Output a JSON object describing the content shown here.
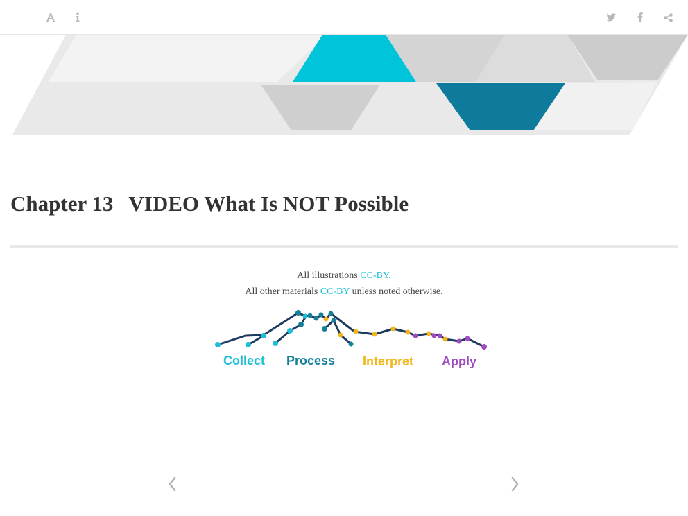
{
  "toolbar": {
    "font_icon": "font-icon",
    "info_icon": "info-icon",
    "twitter_icon": "twitter-icon",
    "facebook_icon": "facebook-icon",
    "share_icon": "share-icon"
  },
  "banner": {
    "colors": [
      "#00c4da",
      "#0e7a9c",
      "#e6e6e6"
    ]
  },
  "chapter": {
    "number": "Chapter 13",
    "title": "VIDEO What Is NOT Possible"
  },
  "credits": {
    "line1_prefix": "All illustrations ",
    "line1_link": "CC-BY.",
    "line2_prefix": "All other materials ",
    "line2_link": "CC-BY",
    "line2_suffix": " unless noted otherwise."
  },
  "logo": {
    "labels": [
      "Collect",
      "Process",
      "Interpret",
      "Apply"
    ],
    "colors": {
      "collect": "#1ebfd6",
      "process": "#167f99",
      "interpret": "#f2b51b",
      "apply": "#a04ac3",
      "line": "#1e3a5f"
    }
  },
  "nav": {
    "prev_icon": "chevron-left-icon",
    "next_icon": "chevron-right-icon"
  }
}
